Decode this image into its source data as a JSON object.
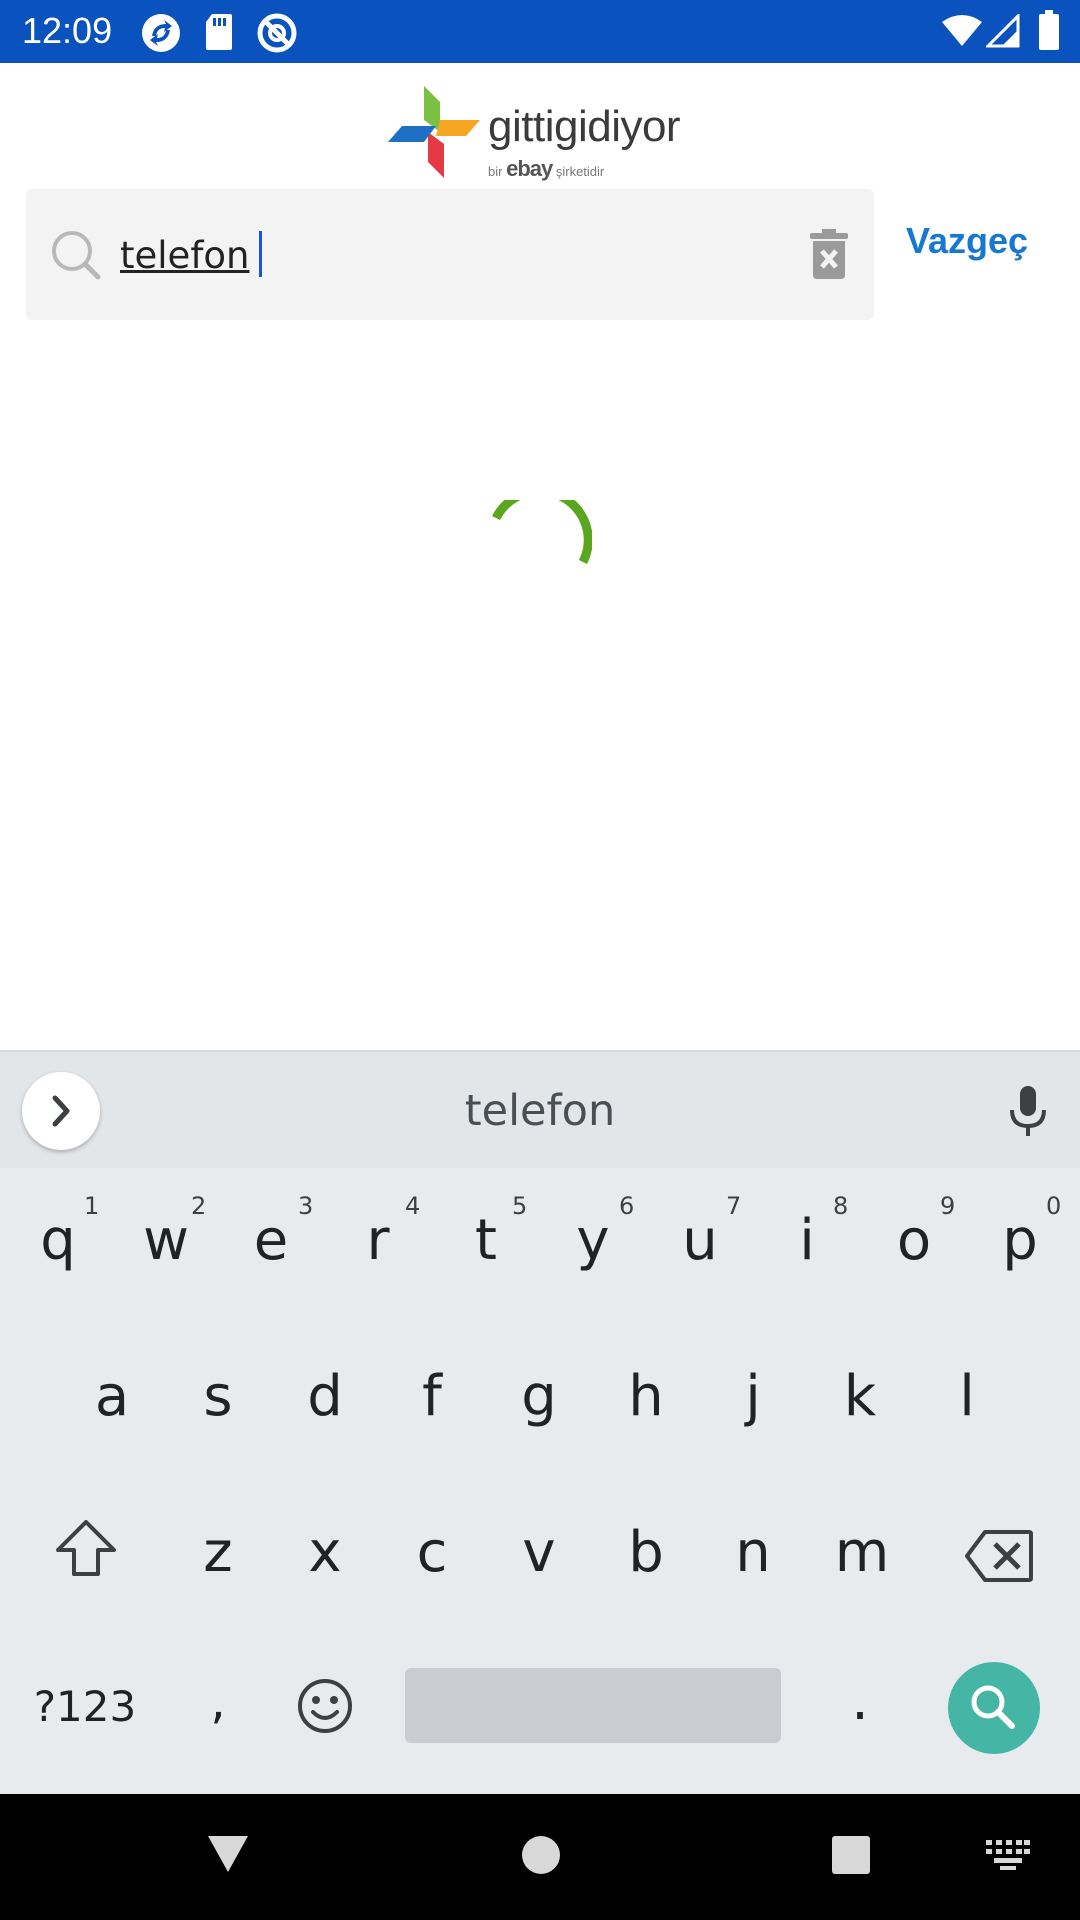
{
  "status_bar": {
    "time": "12:09",
    "background": "#0a52be",
    "icons": [
      "app-sync-icon",
      "sd-card-icon",
      "do-not-disturb-icon",
      "wifi-icon",
      "signal-icon",
      "battery-icon"
    ]
  },
  "header": {
    "logo_word": "gittigidiyor",
    "logo_sub_prefix": "bir",
    "logo_sub_brand": "ebay",
    "logo_sub_suffix": "şirketidir"
  },
  "search": {
    "value": "telefon",
    "cancel_label": "Vazgeç",
    "accent_color": "#1778d2"
  },
  "loading": {
    "spinner_color": "#5aa61f"
  },
  "keyboard": {
    "suggestion": "telefon",
    "row1": [
      {
        "key": "q",
        "hint": "1"
      },
      {
        "key": "w",
        "hint": "2"
      },
      {
        "key": "e",
        "hint": "3"
      },
      {
        "key": "r",
        "hint": "4"
      },
      {
        "key": "t",
        "hint": "5"
      },
      {
        "key": "y",
        "hint": "6"
      },
      {
        "key": "u",
        "hint": "7"
      },
      {
        "key": "i",
        "hint": "8"
      },
      {
        "key": "o",
        "hint": "9"
      },
      {
        "key": "p",
        "hint": "0"
      }
    ],
    "row2": [
      "a",
      "s",
      "d",
      "f",
      "g",
      "h",
      "j",
      "k",
      "l"
    ],
    "row3": [
      "z",
      "x",
      "c",
      "v",
      "b",
      "n",
      "m"
    ],
    "symbols_label": "?123",
    "comma_label": ",",
    "period_label": ".",
    "action_color": "#45b5a6"
  },
  "nav_bar": {
    "icons": [
      "back-icon",
      "home-icon",
      "recents-icon",
      "keyboard-switch-icon"
    ]
  }
}
